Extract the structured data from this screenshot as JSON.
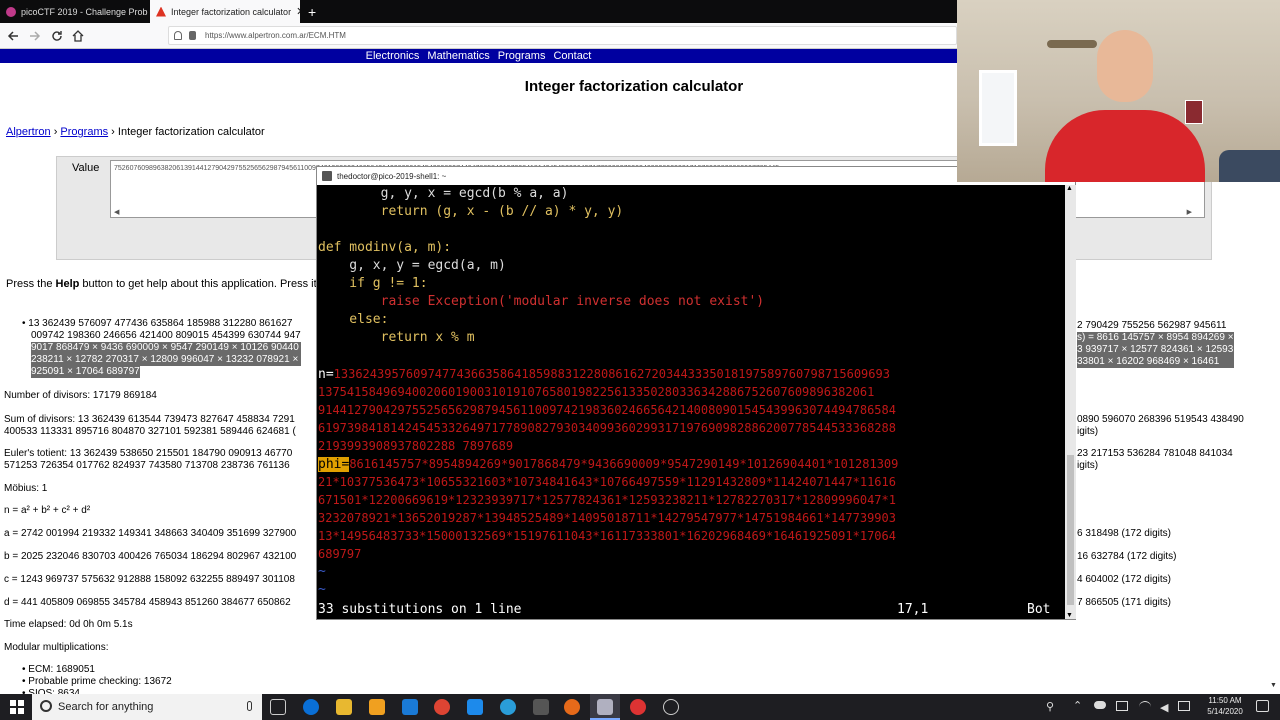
{
  "browser": {
    "tabs": [
      {
        "label": "picoCTF 2019 - Challenge Prob"
      },
      {
        "label": "Integer factorization calculator"
      }
    ],
    "new_tab": "+",
    "close": "✕",
    "url": "https://www.alpertron.com.ar/ECM.HTM"
  },
  "site": {
    "nav": [
      "Electronics",
      "Mathematics",
      "Programs",
      "Contact"
    ],
    "title": "Integer factorization calculator",
    "breadcrumb": {
      "a": "Alpertron",
      "sep1": " › ",
      "b": "Programs",
      "sep2": " › ",
      "c": "Integer factorization calculator"
    },
    "value_label": "Value",
    "value_text": "752607609896382061391441279042975525656298794561100974219836024665642140080901545439963074494786584619739841814245453326497177890827930340993602993171976909828862007785445",
    "help_text_pre": "Press the ",
    "help_text_bold": "Help",
    "help_text_post": " button to get help about this application. Press it a",
    "factor_l1": "13 362439 576097 477436 635864 185988 312280 861627",
    "factor_l2": "009742 198360 246656 421400 809015 454399 630744 947",
    "factor_l3": "9017 868479 × 9436 690009 × 9547 290149 × 10126 90440",
    "factor_l4": "238211 × 12782 270317 × 12809 996047 × 13232 078921 ×",
    "factor_l5": "925091 × 17064 689797",
    "factor_r1": "2 790429 755256 562987 945611",
    "factor_r2": "s) = 8616 145757 × 8954 894269 ×",
    "factor_r3": "3 939717 × 12577 824361 × 12593",
    "factor_r4": "33801 × 16202 968469 × 16461",
    "divisors": "Number of divisors: 17179 869184",
    "sum_l1": "Sum of divisors: 13 362439 613544 739473 827647 458834 7291",
    "sum_l2": "400533 113331 895716 804870 327101 592381 589446 624681 (",
    "sum_r1": "0890 596070 268396 519543 438490",
    "sum_r2": "igits)",
    "tot_l1": "Euler's totient: 13 362439 538650 215501 184790 090913 46770",
    "tot_l2": "571253 726354 017762 824937 743580 713708 238736 761136",
    "tot_r1": "23 217153 536284 781048 841034",
    "tot_r2": "igits)",
    "mobius": "Möbius: 1",
    "sumsq": "n = a² + b² + c² + d²",
    "a": "a = 2742 001994 219332 149341 348663 340409 351699 327900",
    "b": "b = 2025 232046 830703 400426 765034 186294 802967 432100",
    "c": "c = 1243 969737 575632 912888 158092 632255 889497 301108",
    "d": "d = 441 405809 069855 345784 458943 851260 384677 650862",
    "a_r": "6 318498 (172 digits)",
    "b_r": "16 632784 (172 digits)",
    "c_r": "4 604002 (172 digits)",
    "d_r": "7 866505 (171 digits)",
    "elapsed": "Time elapsed: 0d 0h 0m 5.1s",
    "modmul": "Modular multiplications:",
    "ecm": "ECM: 1689051",
    "ppc": "Probable prime checking: 13672",
    "siqs": "SIQS: 8634"
  },
  "terminal": {
    "title": "thedoctor@pico-2019-shell1: ~",
    "code": [
      "        g, y, x = egcd(b % a, a)",
      "        return (g, x - (b // a) * y, y)",
      "",
      "def modinv(a, m):",
      "    g, x, y = egcd(a, m)",
      "    if g != 1:",
      "        raise Exception('modular inverse does not exist')",
      "    else:",
      "        return x % m"
    ],
    "n_prefix": "n=",
    "n_lines": [
      "13362439576097477436635864185988312280861627203443335018197589760798715609693",
      "13754158496940020601900310191076580198225613350280336342886752607609896382061",
      "91441279042975525656298794561100974219836024665642140080901545439963074494786584",
      "61973984181424545332649717789082793034099360299317197690982886200778544533368288",
      "2193993908937802288 7897689"
    ],
    "phi_prefix": "phi=",
    "phi_lines": [
      "8616145757*8954894269*9017868479*9436690009*9547290149*10126904401*101281309",
      "21*10377536473*10655321603*10734841643*10766497559*11291432809*11424071447*11616",
      "671501*12200669619*12323939717*12577824361*12593238211*12782270317*12809996047*1",
      "3232078921*13652019287*13948525489*14095018711*14279547977*14751984661*147739903",
      "13*14956483733*15000132569*15197611043*16117333801*16202968469*16461925091*17064",
      "689797"
    ],
    "tilde": "~",
    "status": "33 substitutions on 1 line",
    "pos": "17,1",
    "scroll": "Bot"
  },
  "taskbar": {
    "search_placeholder": "Search for anything",
    "time": "11:50 AM",
    "date": "5/14/2020"
  }
}
